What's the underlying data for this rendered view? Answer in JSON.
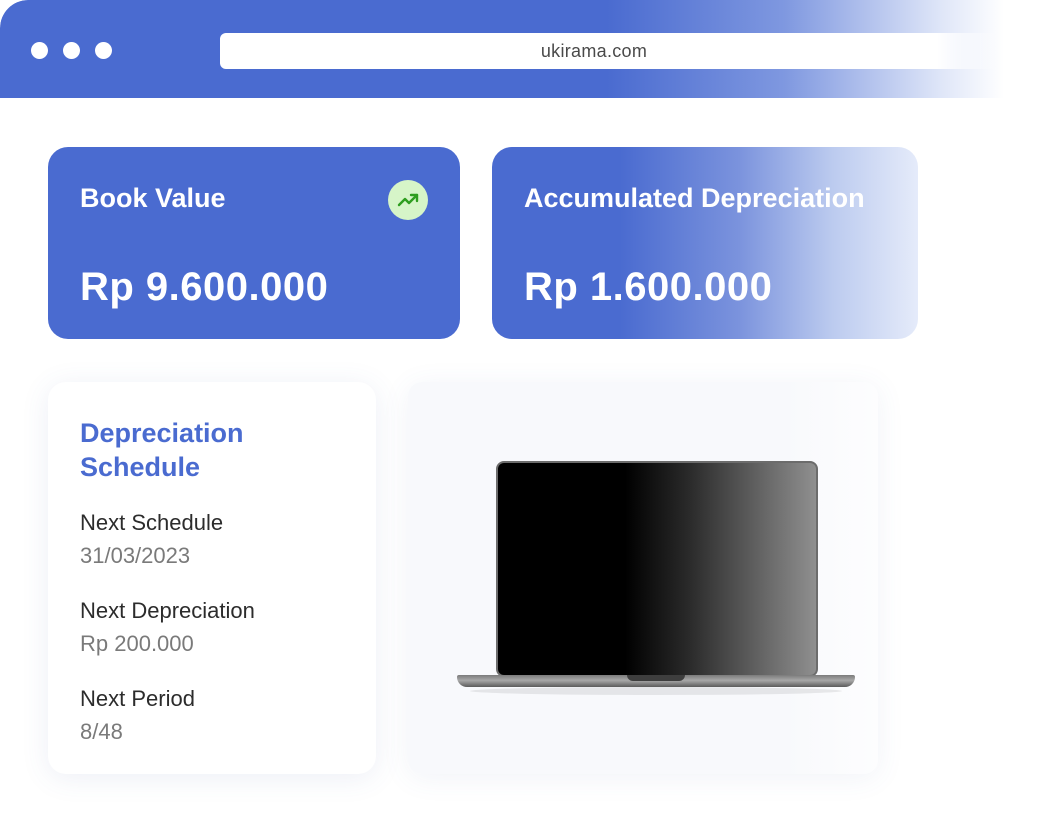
{
  "browser": {
    "url": "ukirama.com"
  },
  "cards": {
    "book_value": {
      "title": "Book Value",
      "value": "Rp 9.600.000",
      "trend_icon": "trending-up-icon"
    },
    "accumulated_depreciation": {
      "title": "Accumulated Depreciation",
      "value": "Rp 1.600.000"
    }
  },
  "schedule": {
    "title": "Depreciation Schedule",
    "items": [
      {
        "label": "Next Schedule",
        "value": "31/03/2023"
      },
      {
        "label": "Next Depreciation",
        "value": "Rp 200.000"
      },
      {
        "label": "Next Period",
        "value": "8/48"
      }
    ]
  },
  "colors": {
    "brand_blue": "#4a6bd0",
    "trend_green_bg": "#d6f5c8",
    "trend_green": "#2e9e1f"
  }
}
